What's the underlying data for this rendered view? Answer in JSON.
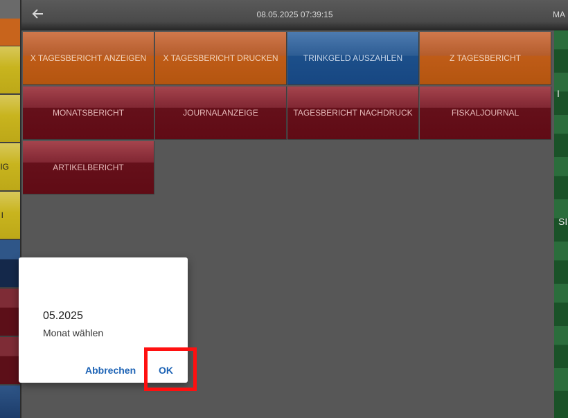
{
  "topbar": {
    "datetime": "08.05.2025 07:39:15",
    "user_fragment": "MA"
  },
  "left_column": {
    "cells": [
      {
        "color": "#c8641c",
        "label": ""
      },
      {
        "color": "#c8b41e",
        "label": ""
      },
      {
        "color": "#c8b41e",
        "label": ""
      },
      {
        "color": "#c8b41e",
        "label": "IG"
      },
      {
        "color": "#c8b41e",
        "label": "I"
      },
      {
        "color": "#1c3c6a",
        "label": ""
      },
      {
        "color": "#14284a",
        "label": ""
      },
      {
        "color": "#6a1a24",
        "label": ""
      },
      {
        "color": "#5c0f18",
        "label": ""
      },
      {
        "color": "#6a1a24",
        "label": ""
      },
      {
        "color": "#5c0f18",
        "label": ""
      },
      {
        "color": "#1c3c6a",
        "label": ""
      }
    ]
  },
  "right_column": {
    "text": "SI",
    "text2": "I"
  },
  "reports": {
    "tiles": [
      {
        "label": "X TAGESBERICHT ANZEIGEN",
        "color": "orange"
      },
      {
        "label": "X TAGESBERICHT DRUCKEN",
        "color": "orange"
      },
      {
        "label": "TRINKGELD AUSZAHLEN",
        "color": "blue"
      },
      {
        "label": "Z TAGESBERICHT",
        "color": "orange"
      },
      {
        "label": "MONATSBERICHT",
        "color": "red"
      },
      {
        "label": "JOURNALANZEIGE",
        "color": "red"
      },
      {
        "label": "TAGESBERICHT NACHDRUCK",
        "color": "red"
      },
      {
        "label": "FISKALJOURNAL",
        "color": "red"
      },
      {
        "label": "ARTIKELBERICHT",
        "color": "red"
      }
    ]
  },
  "dialog": {
    "value": "05.2025",
    "label": "Monat wählen",
    "cancel_label": "Abbrechen",
    "ok_label": "OK"
  },
  "colors": {
    "accent_link": "#1d63b5",
    "highlight": "#ff1010"
  }
}
